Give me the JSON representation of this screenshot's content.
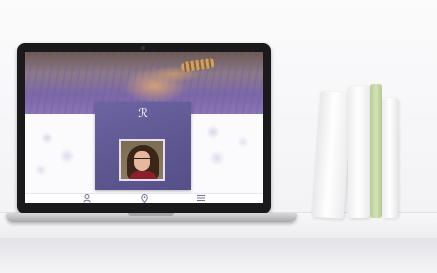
{
  "website": {
    "logo_glyph": "ℛ",
    "tagline": "",
    "name_line": "",
    "nav": {
      "person_icon": "person-icon",
      "pin_icon": "location-pin-icon",
      "list_icon": "list-icon"
    }
  },
  "colors": {
    "card_purple": "#5d568f",
    "book_green": "#c6d9a6",
    "laptop_black": "#1a1a1c"
  }
}
